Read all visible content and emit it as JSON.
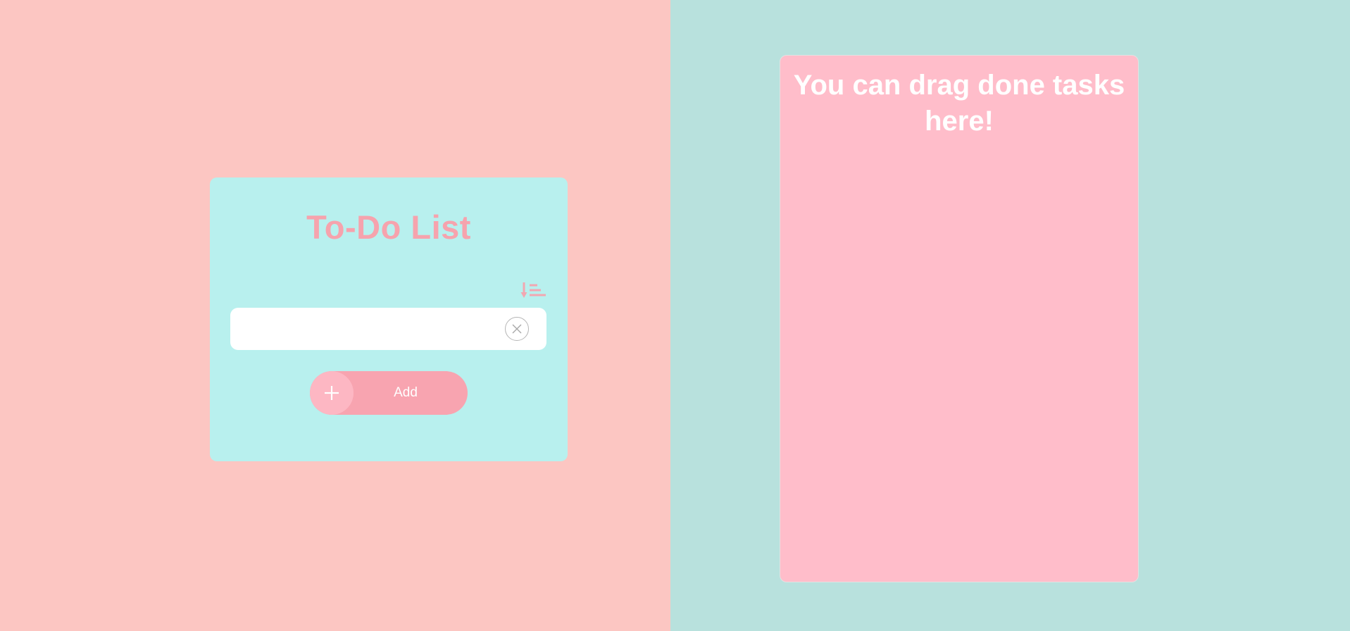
{
  "todo": {
    "title": "To-Do List",
    "input": {
      "value": "",
      "placeholder": ""
    },
    "add_button_label": "Add",
    "icons": {
      "sort": "sort-icon",
      "clear": "close-icon",
      "add": "plus-icon"
    }
  },
  "done_panel": {
    "title": "You can drag done tasks here!"
  },
  "colors": {
    "left_background": "#fcc6c2",
    "right_background": "#b8e1dd",
    "card_background": "#b8f0ee",
    "title_color": "#f6a3ad",
    "add_button": "#f8a4b0",
    "add_icon_circle": "#fdb7c3",
    "done_panel_background": "#ffbdca"
  }
}
